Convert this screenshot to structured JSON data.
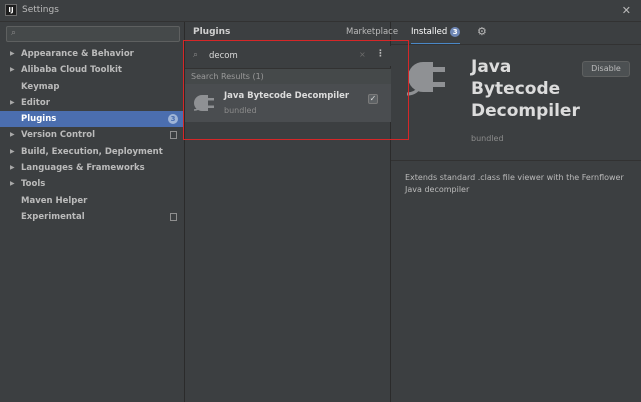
{
  "window": {
    "title": "Settings",
    "app_icon_text": "IJ",
    "close_glyph": "✕"
  },
  "sidebar": {
    "search": {
      "placeholder": "",
      "icon": "search-icon"
    },
    "items": [
      {
        "label": "Appearance & Behavior",
        "expandable": true
      },
      {
        "label": "Alibaba Cloud Toolkit",
        "expandable": true
      },
      {
        "label": "Keymap",
        "expandable": false
      },
      {
        "label": "Editor",
        "expandable": true
      },
      {
        "label": "Plugins",
        "expandable": false,
        "selected": true,
        "badge": "3"
      },
      {
        "label": "Version Control",
        "expandable": true,
        "copy_icon": true
      },
      {
        "label": "Build, Execution, Deployment",
        "expandable": true
      },
      {
        "label": "Languages & Frameworks",
        "expandable": true
      },
      {
        "label": "Tools",
        "expandable": true
      },
      {
        "label": "Maven Helper",
        "expandable": false
      },
      {
        "label": "Experimental",
        "expandable": false,
        "copy_icon": true
      }
    ]
  },
  "plugins_panel": {
    "header": "Plugins",
    "search": {
      "value": "decom",
      "placeholder": "",
      "clear_glyph": "×",
      "menu_glyph": "⋮"
    },
    "results_label": "Search Results (1)",
    "results": [
      {
        "name": "Java Bytecode Decompiler",
        "subtitle": "bundled",
        "enabled": true,
        "check_glyph": "✓"
      }
    ]
  },
  "tabs": {
    "marketplace": "Marketplace",
    "installed": "Installed",
    "installed_badge": "3",
    "gear_glyph": "⚙"
  },
  "detail": {
    "title": "Java Bytecode Decompiler",
    "disable_label": "Disable",
    "bundled_label": "bundled",
    "description": "Extends standard .class file viewer with the Fernflower Java decompiler"
  },
  "colors": {
    "background": "#3c3f41",
    "selection": "#4b6eaf",
    "highlight_box": "#d62728",
    "tab_underline": "#4a88c7"
  }
}
